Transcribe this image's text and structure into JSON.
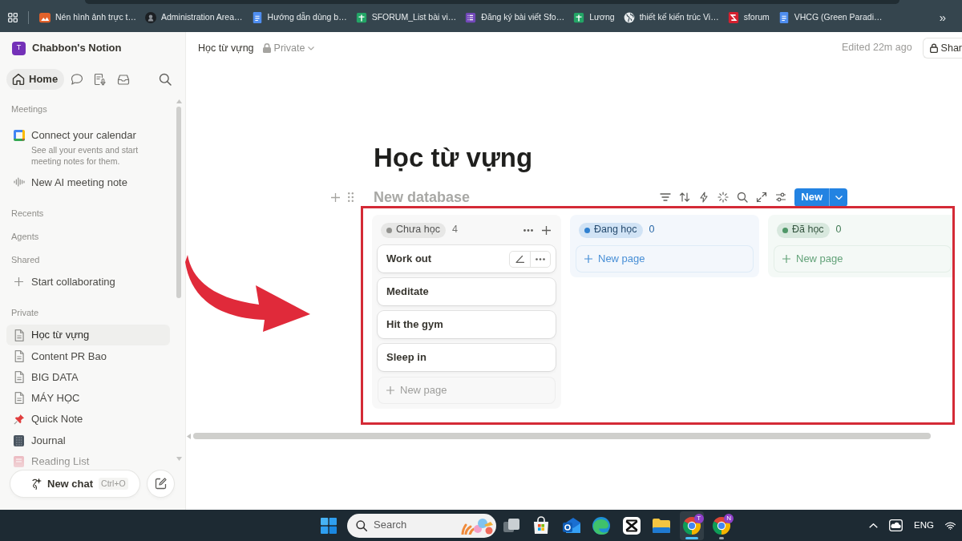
{
  "browser": {
    "bookmarks": [
      {
        "kind": "photo",
        "label": "Nén hình ảnh trực t…"
      },
      {
        "kind": "circle",
        "label": "Administration Area…"
      },
      {
        "kind": "doc",
        "label": "Hướng dẫn dùng b…"
      },
      {
        "kind": "sheet",
        "label": "SFORUM_List bài vi…"
      },
      {
        "kind": "form",
        "label": "Đăng ký bài viết Sfo…"
      },
      {
        "kind": "sheet",
        "label": "Lương"
      },
      {
        "kind": "globe",
        "label": "thiết kế kiến trúc Vi…"
      },
      {
        "kind": "letter",
        "label": "sforum"
      },
      {
        "kind": "doc",
        "label": "VHCG (Green Paradi…"
      }
    ],
    "more": "»"
  },
  "sidebar": {
    "workspace": {
      "avatar": "T",
      "name": "Chabbon's Notion"
    },
    "nav": [
      {
        "kind": "home",
        "label": "Home",
        "selected": true
      },
      {
        "kind": "chat",
        "selected": false
      },
      {
        "kind": "meeting",
        "selected": false
      },
      {
        "kind": "inbox",
        "selected": false
      }
    ],
    "sections": [
      {
        "title": "Meetings",
        "items": [
          {
            "kind": "calendar",
            "label": "Connect your calendar",
            "description": "See all your events and start meeting notes for them."
          },
          {
            "kind": "wave",
            "label": "New AI meeting note"
          }
        ]
      },
      {
        "title": "Recents"
      },
      {
        "title": "Agents"
      },
      {
        "title": "Shared",
        "items": [
          {
            "kind": "plus",
            "label": "Start collaborating"
          }
        ]
      },
      {
        "title": "Private",
        "items": [
          {
            "kind": "page",
            "label": "Học từ vựng",
            "selected": true
          },
          {
            "kind": "page",
            "label": "Content PR Bao",
            "selected": false
          },
          {
            "kind": "page",
            "label": "BIG DATA",
            "selected": false
          },
          {
            "kind": "page",
            "label": "MÁY HỌC",
            "selected": false
          },
          {
            "kind": "pin",
            "label": "Quick Note",
            "selected": false
          },
          {
            "kind": "journal",
            "label": "Journal",
            "selected": false
          },
          {
            "kind": "book",
            "label": "Reading List",
            "selected": false
          }
        ]
      }
    ],
    "new_chat": {
      "label": "New chat",
      "shortcut": "Ctrl+O"
    }
  },
  "page": {
    "breadcrumb": "Học từ vựng",
    "visibility": "Private",
    "edited": "Edited 22m ago",
    "share": "Shar",
    "title": "Học từ vựng",
    "database": {
      "placeholder": "New database",
      "new_button": "New",
      "columns": [
        {
          "label": "Chưa học",
          "count": "4",
          "color": "#91918e",
          "hovered": true,
          "cards": [
            {
              "title": "Work out",
              "hovered": true
            },
            {
              "title": "Meditate",
              "hovered": false
            },
            {
              "title": "Hit the gym",
              "hovered": false
            },
            {
              "title": "Sleep in",
              "hovered": false
            }
          ],
          "add_label": "New page"
        },
        {
          "label": "Đang học",
          "count": "0",
          "color": "#2f80d0",
          "hovered": false,
          "add_label": "New page"
        },
        {
          "label": "Đã học",
          "count": "0",
          "color": "#4f9768",
          "hovered": false,
          "add_label": "New page"
        }
      ]
    }
  },
  "annotations": {
    "frame": true,
    "arrow": true
  },
  "taskbar": {
    "search": {
      "placeholder": "Search"
    },
    "apps": [
      {
        "kind": "taskview",
        "running": false,
        "active": false
      },
      {
        "kind": "store",
        "running": false,
        "active": false
      },
      {
        "kind": "mail",
        "running": false,
        "active": false
      },
      {
        "kind": "swirl",
        "running": false,
        "active": false
      },
      {
        "kind": "clip",
        "running": false,
        "active": false
      },
      {
        "kind": "folder",
        "running": false,
        "active": false
      },
      {
        "kind": "browser",
        "badge": "T",
        "running": true,
        "active": true
      },
      {
        "kind": "browser",
        "badge": "N",
        "running": true,
        "active": false
      }
    ],
    "tray": {
      "language": "ENG"
    }
  }
}
